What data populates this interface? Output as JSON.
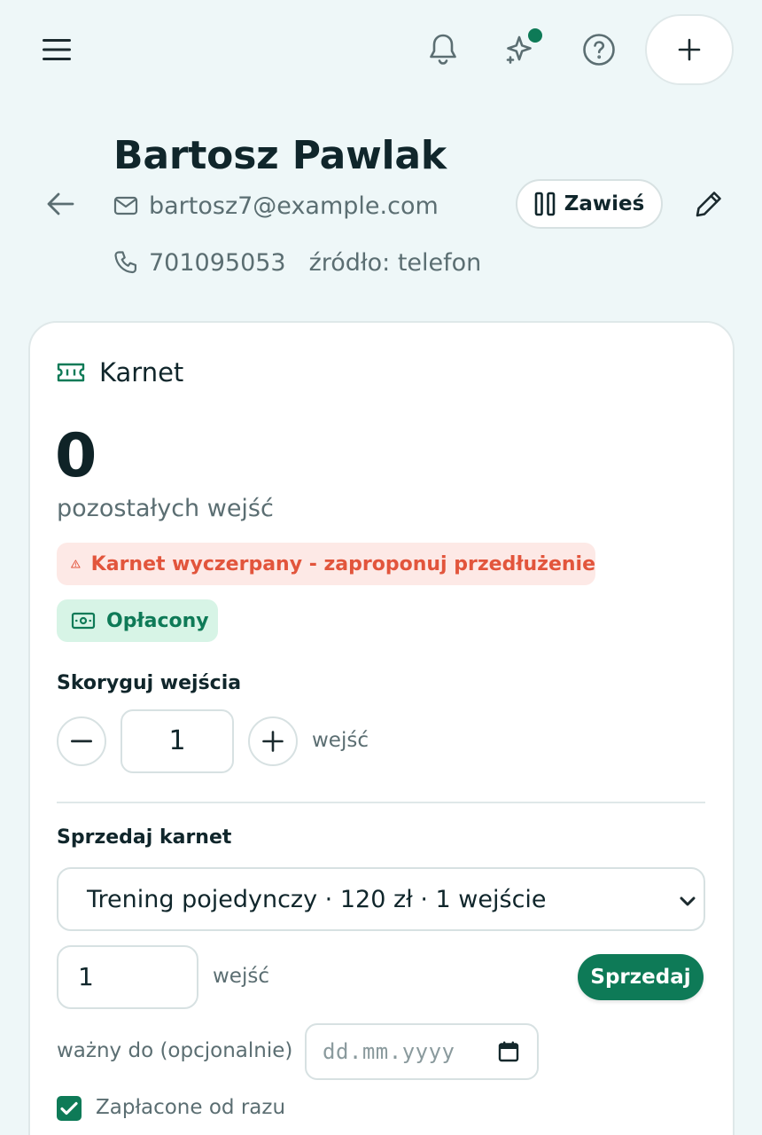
{
  "header": {
    "name": "Bartosz Pawlak",
    "email": "bartosz7@example.com",
    "phone": "701095053",
    "source": "źródło: telefon",
    "suspend_label": "Zawieś"
  },
  "topbar": {
    "add_symbol": "+"
  },
  "card": {
    "title": "Karnet",
    "remaining_value": "0",
    "remaining_label": "pozostałych wejść",
    "alert_text": "Karnet wyczerpany - zaproponuj przedłużenie",
    "paid_badge": "Opłacony",
    "adjust": {
      "label": "Skoryguj wejścia",
      "value": "1",
      "unit": "wejść"
    },
    "sell": {
      "label": "Sprzedaj karnet",
      "selected_option": "Trening pojedynczy · 120 zł · 1 wejście",
      "qty_value": "1",
      "qty_unit": "wejść",
      "button_label": "Sprzedaj",
      "valid_label": "ważny do (opcjonalnie)",
      "date_placeholder": "dd.mm.yyyy",
      "paid_now_label": "Zapłacone od razu",
      "paid_now_checked": true
    }
  },
  "colors": {
    "accent": "#0e7a57",
    "danger": "#e2553c",
    "background": "#eef7f8"
  }
}
